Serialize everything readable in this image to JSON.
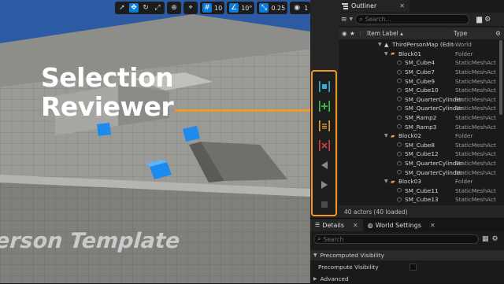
{
  "viewport": {
    "callout_line1": "Selection",
    "callout_line2": "Reviewer",
    "floor_text": "erson Template",
    "toolbar": {
      "grid_snap_value": "10",
      "rotation_snap_value": "10°",
      "scale_snap_value": "0.25",
      "camera_speed_value": "1"
    }
  },
  "selection_reviewer": {
    "buttons": [
      {
        "name": "review-selection-icon",
        "color": "#2fb0d8"
      },
      {
        "name": "add-to-selection-icon",
        "color": "#3cc447"
      },
      {
        "name": "list-selection-icon",
        "color": "#e2a12a"
      },
      {
        "name": "remove-from-selection-icon",
        "color": "#d44040"
      },
      {
        "name": "previous-icon",
        "color": "#8a8a8a"
      },
      {
        "name": "play-icon",
        "color": "#8a8a8a"
      },
      {
        "name": "stop-icon",
        "color": "#8a8a8a"
      }
    ]
  },
  "outliner": {
    "tab_label": "Outliner",
    "search_placeholder": "Search...",
    "columns": {
      "item_label": "Item Label ▴",
      "type": "Type"
    },
    "rows": [
      {
        "indent": 0,
        "caret": "▼",
        "icon": "map",
        "label": "ThirdPersonMap (Editor)",
        "type": "World"
      },
      {
        "indent": 1,
        "caret": "▼",
        "icon": "folder",
        "label": "Block01",
        "type": "Folder"
      },
      {
        "indent": 2,
        "caret": "",
        "icon": "mesh",
        "label": "SM_Cube4",
        "type": "StaticMeshActor"
      },
      {
        "indent": 2,
        "caret": "",
        "icon": "mesh",
        "label": "SM_Cube7",
        "type": "StaticMeshActor"
      },
      {
        "indent": 2,
        "caret": "",
        "icon": "mesh",
        "label": "SM_Cube9",
        "type": "StaticMeshActor"
      },
      {
        "indent": 2,
        "caret": "",
        "icon": "mesh",
        "label": "SM_Cube10",
        "type": "StaticMeshActor"
      },
      {
        "indent": 2,
        "caret": "",
        "icon": "mesh",
        "label": "SM_QuarterCylinder",
        "type": "StaticMeshActor"
      },
      {
        "indent": 2,
        "caret": "",
        "icon": "mesh",
        "label": "SM_QuarterCylinder",
        "type": "StaticMeshActor"
      },
      {
        "indent": 2,
        "caret": "",
        "icon": "mesh",
        "label": "SM_Ramp2",
        "type": "StaticMeshActor"
      },
      {
        "indent": 2,
        "caret": "",
        "icon": "mesh",
        "label": "SM_Ramp3",
        "type": "StaticMeshActor"
      },
      {
        "indent": 1,
        "caret": "▼",
        "icon": "folder",
        "label": "Block02",
        "type": "Folder"
      },
      {
        "indent": 2,
        "caret": "",
        "icon": "mesh",
        "label": "SM_Cube8",
        "type": "StaticMeshActor"
      },
      {
        "indent": 2,
        "caret": "",
        "icon": "mesh",
        "label": "SM_Cube12",
        "type": "StaticMeshActor"
      },
      {
        "indent": 2,
        "caret": "",
        "icon": "mesh",
        "label": "SM_QuarterCylinder",
        "type": "StaticMeshActor"
      },
      {
        "indent": 2,
        "caret": "",
        "icon": "mesh",
        "label": "SM_QuarterCylinder",
        "type": "StaticMeshActor"
      },
      {
        "indent": 1,
        "caret": "▼",
        "icon": "folder",
        "label": "Block03",
        "type": "Folder"
      },
      {
        "indent": 2,
        "caret": "",
        "icon": "mesh",
        "label": "SM_Cube11",
        "type": "StaticMeshActor"
      },
      {
        "indent": 2,
        "caret": "",
        "icon": "mesh",
        "label": "SM_Cube13",
        "type": "StaticMeshActor"
      }
    ],
    "status": "40 actors (40 loaded)"
  },
  "details": {
    "tab_details": "Details",
    "tab_world_settings": "World Settings",
    "search_placeholder": "Search",
    "section_precomputed": "Precomputed Visibility",
    "prop_precompute": "Precompute Visibility",
    "section_advanced": "Advanced"
  },
  "colors": {
    "accent_orange": "#f09a24",
    "selection_blue": "#0e7ad8",
    "folder_yellow": "#d8a44a"
  }
}
